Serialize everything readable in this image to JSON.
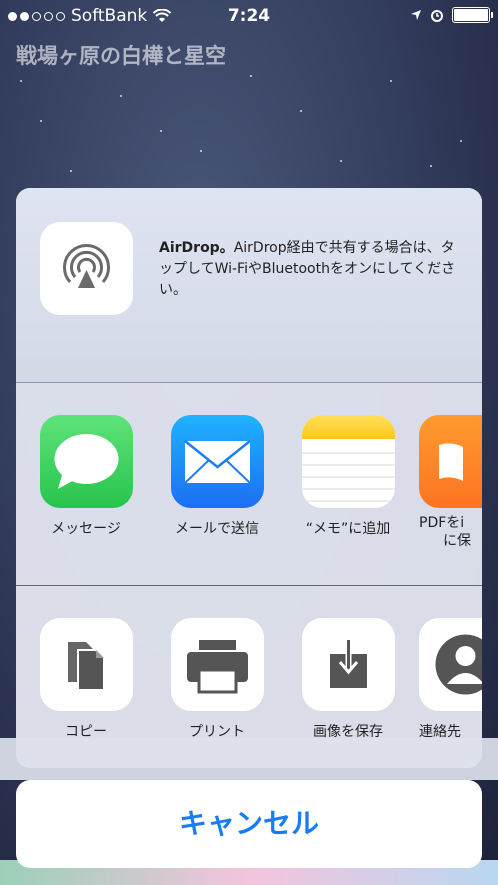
{
  "status_bar": {
    "carrier": "SoftBank",
    "time": "7:24",
    "signal_bars": 2
  },
  "page": {
    "title": "戦場ヶ原の白樺と星空"
  },
  "share_sheet": {
    "airdrop": {
      "heading": "AirDrop。",
      "description": "AirDrop経由で共有する場合は、タップしてWi-FiやBluetoothをオンにしてください。"
    },
    "apps": [
      {
        "label": "メッセージ",
        "icon": "messages-icon"
      },
      {
        "label": "メールで送信",
        "icon": "mail-icon"
      },
      {
        "label": "“メモ”に追加",
        "icon": "notes-icon"
      },
      {
        "label": "PDFをi",
        "label2": "に保",
        "icon": "ibooks-icon"
      }
    ],
    "actions": [
      {
        "label": "コピー",
        "icon": "copy-icon"
      },
      {
        "label": "プリント",
        "icon": "print-icon"
      },
      {
        "label": "画像を保存",
        "icon": "save-image-icon"
      },
      {
        "label": "連絡先",
        "icon": "contact-icon"
      }
    ],
    "cancel_label": "キャンセル"
  },
  "colors": {
    "accent": "#1a7cf5",
    "messages_green": "#2fd158",
    "mail_blue": "#1f8cf9",
    "notes_yellow": "#fdd22b",
    "ibooks_orange": "#fe8a26"
  }
}
